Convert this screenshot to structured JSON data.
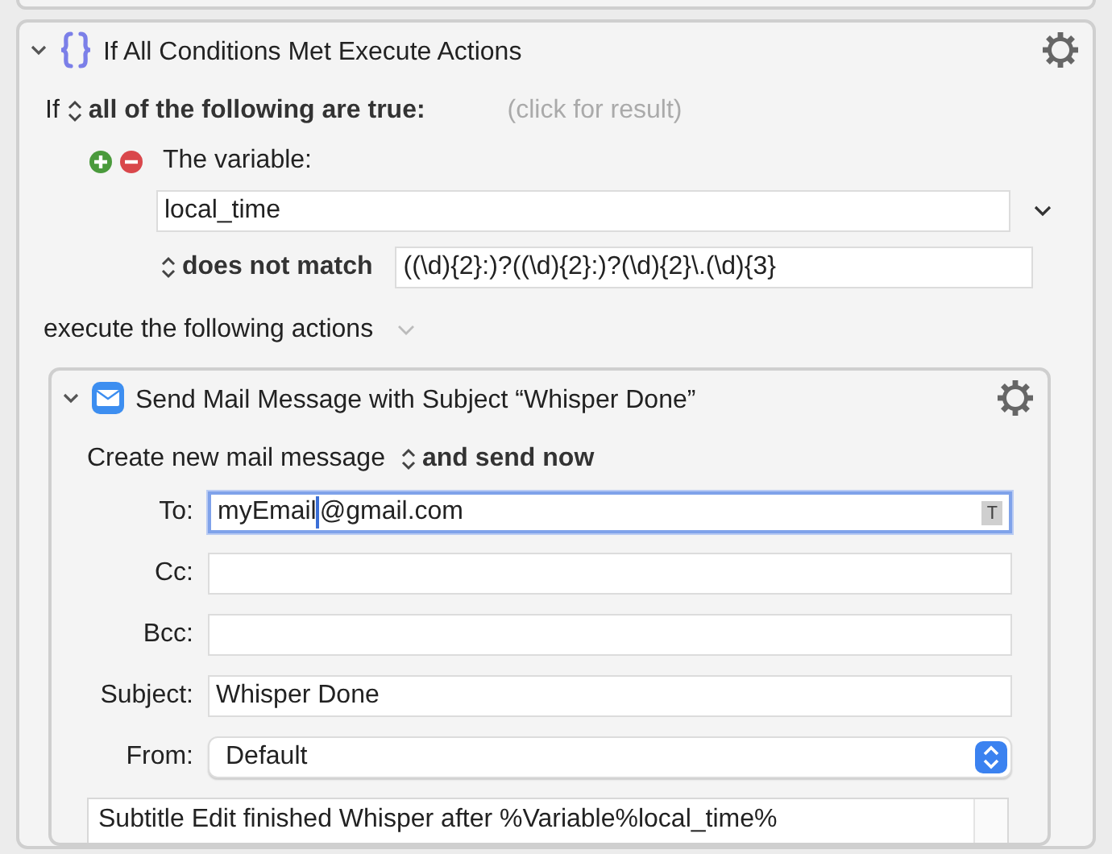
{
  "condition_action": {
    "title": "If All Conditions Met Execute Actions",
    "expanded": true,
    "if_label": "If",
    "match_mode": "all of the following are true:",
    "result_hint": "(click for result)",
    "condition": {
      "label": "The variable:",
      "variable": "local_time",
      "operator": "does not match",
      "pattern": "((\\d){2}:)?((\\d){2}:)?(\\d){2}\\.(\\d){3}"
    },
    "execute_label": "execute the following actions"
  },
  "mail_action": {
    "title": "Send Mail Message with Subject “Whisper Done”",
    "expanded": true,
    "mode_label": "Create new mail message",
    "send_option": "and send now",
    "fields": [
      {
        "label": "To:",
        "value": "myEmail@gmail.com",
        "focused": true,
        "token_button": "T"
      },
      {
        "label": "Cc:",
        "focused": false
      },
      {
        "label": "Bcc:",
        "focused": false
      },
      {
        "label": "Subject:",
        "value": "Whisper Done",
        "focused": false
      }
    ],
    "from": {
      "label": "From:",
      "value": "Default"
    },
    "body": "Subtitle Edit finished Whisper after %Variable%local_time%"
  }
}
